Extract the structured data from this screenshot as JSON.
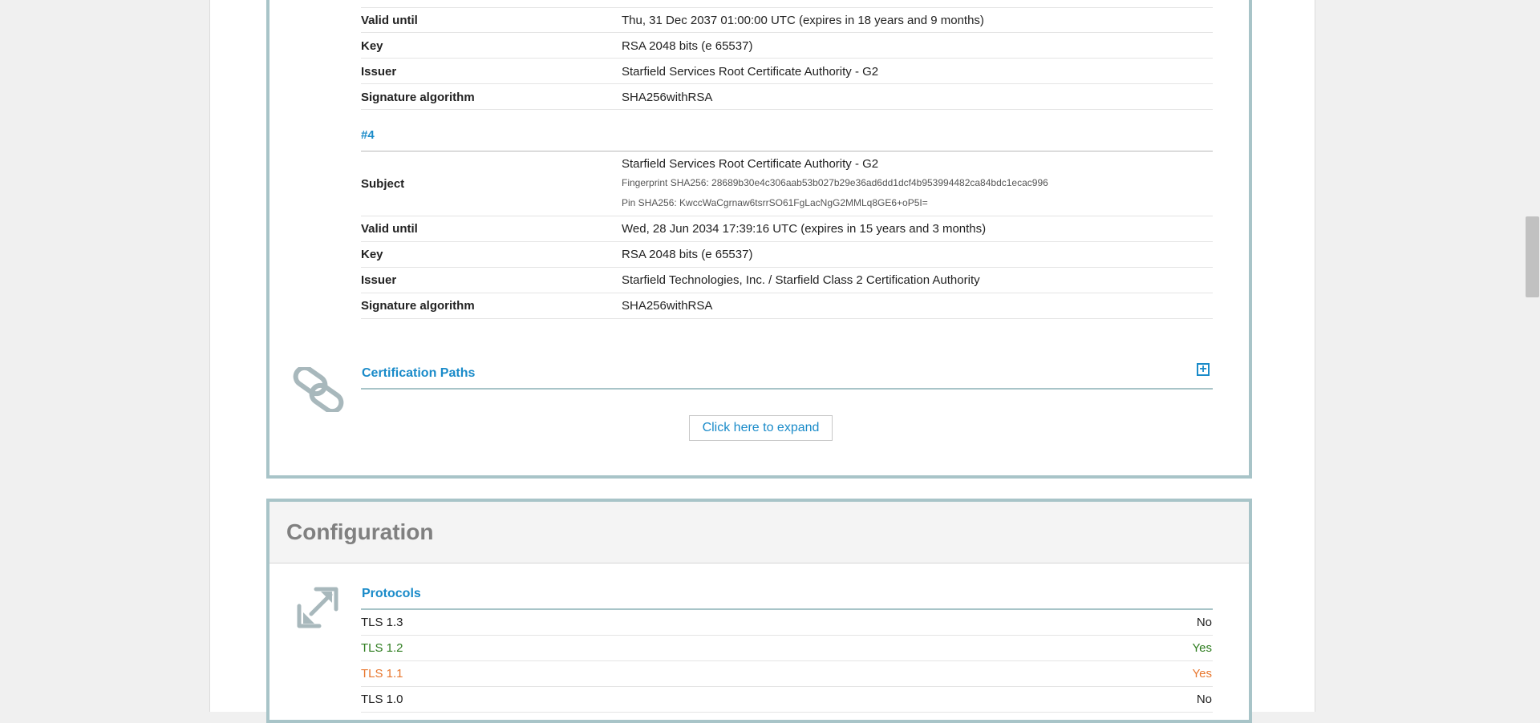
{
  "cert_rows_top": [
    {
      "label": "Valid until",
      "value": "Thu, 31 Dec 2037 01:00:00 UTC (expires in 18 years and 9 months)"
    },
    {
      "label": "Key",
      "value": "RSA 2048 bits (e 65537)"
    },
    {
      "label": "Issuer",
      "value": "Starfield Services Root Certificate Authority - G2"
    },
    {
      "label": "Signature algorithm",
      "value": "SHA256withRSA"
    }
  ],
  "cert4": {
    "heading": "#4",
    "subject_label": "Subject",
    "subject_value": "Starfield Services Root Certificate Authority - G2",
    "fingerprint": "Fingerprint SHA256: 28689b30e4c306aab53b027b29e36ad6dd1dcf4b953994482ca84bdc1ecac996",
    "pin": "Pin SHA256: KwccWaCgrnaw6tsrrSO61FgLacNgG2MMLq8GE6+oP5I=",
    "rows": [
      {
        "label": "Valid until",
        "value": "Wed, 28 Jun 2034 17:39:16 UTC (expires in 15 years and 3 months)"
      },
      {
        "label": "Key",
        "value": "RSA 2048 bits (e 65537)"
      },
      {
        "label": "Issuer",
        "value": "Starfield Technologies, Inc. / Starfield Class 2 Certification Authority"
      },
      {
        "label": "Signature algorithm",
        "value": "SHA256withRSA"
      }
    ]
  },
  "cert_paths": {
    "title": "Certification Paths",
    "expand_label": "Click here to expand",
    "plus_icon": "plus-square-icon",
    "section_icon": "chain-link-icon"
  },
  "configuration": {
    "title": "Configuration",
    "section_icon": "expand-arrows-icon",
    "protocols_title": "Protocols",
    "protocols": [
      {
        "name": "TLS 1.3",
        "value": "No",
        "color": "#222222"
      },
      {
        "name": "TLS 1.2",
        "value": "Yes",
        "color": "#2e7d1f"
      },
      {
        "name": "TLS 1.1",
        "value": "Yes",
        "color": "#e8772e"
      },
      {
        "name": "TLS 1.0",
        "value": "No",
        "color": "#222222"
      }
    ]
  },
  "colors": {
    "accent": "#1a8bc9",
    "card_border": "#a8c4c8"
  }
}
